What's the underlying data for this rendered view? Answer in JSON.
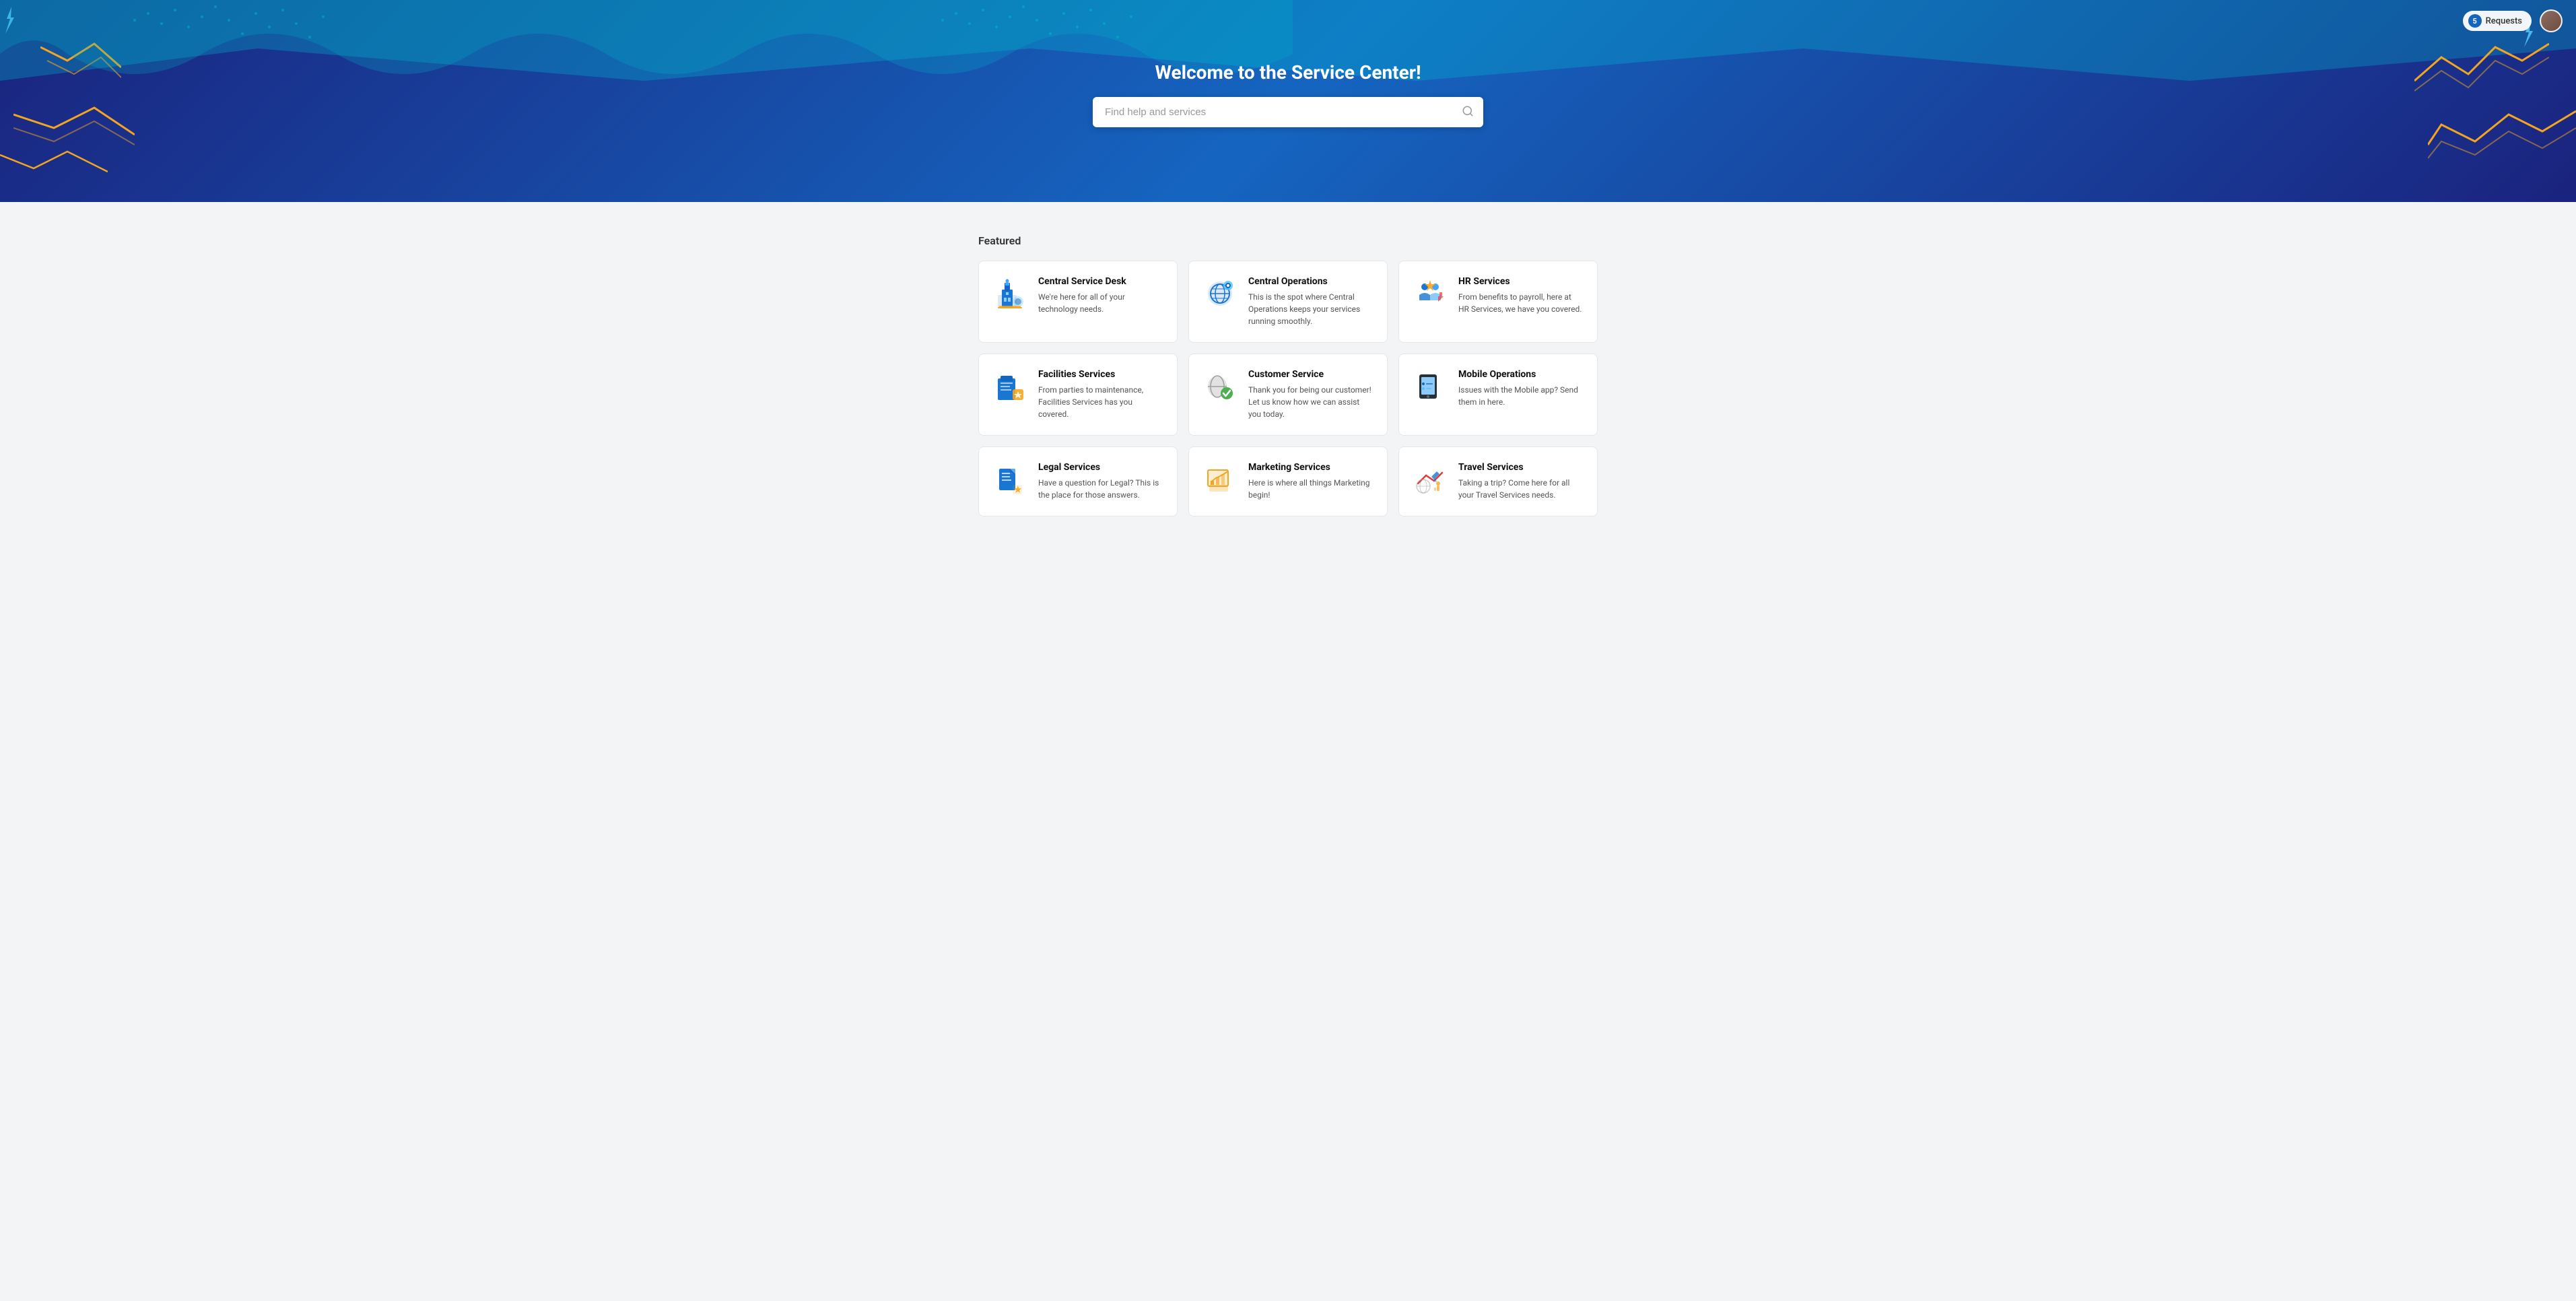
{
  "header": {
    "title": "Welcome to the Service Center!",
    "search_placeholder": "Find help and services",
    "top_nav": {
      "requests_label": "Requests",
      "requests_count": "5"
    }
  },
  "main": {
    "featured_label": "Featured",
    "cards": [
      {
        "id": "central-service-desk",
        "title": "Central Service Desk",
        "desc": "We're here for all of your technology needs.",
        "icon_color": "#1565c0",
        "icon_type": "building"
      },
      {
        "id": "central-operations",
        "title": "Central Operations",
        "desc": "This is the spot where Central Operations keeps your services running smoothly.",
        "icon_color": "#1565c0",
        "icon_type": "gear-globe"
      },
      {
        "id": "hr-services",
        "title": "HR Services",
        "desc": "From benefits to payroll, here at HR Services, we have you covered.",
        "icon_color": "#1565c0",
        "icon_type": "people-star"
      },
      {
        "id": "facilities-services",
        "title": "Facilities Services",
        "desc": "From parties to maintenance, Facilities Services has you covered.",
        "icon_color": "#f57c00",
        "icon_type": "facilities"
      },
      {
        "id": "customer-service",
        "title": "Customer Service",
        "desc": "Thank you for being our customer! Let us know how we can assist you today.",
        "icon_color": "#4caf50",
        "icon_type": "customer"
      },
      {
        "id": "mobile-operations",
        "title": "Mobile Operations",
        "desc": "Issues with the Mobile app? Send them in here.",
        "icon_color": "#1565c0",
        "icon_type": "mobile"
      },
      {
        "id": "legal-services",
        "title": "Legal Services",
        "desc": "Have a question for Legal? This is the place for those answers.",
        "icon_color": "#f57c00",
        "icon_type": "legal"
      },
      {
        "id": "marketing-services",
        "title": "Marketing Services",
        "desc": "Here is where all things Marketing begin!",
        "icon_color": "#f57c00",
        "icon_type": "marketing"
      },
      {
        "id": "travel-services",
        "title": "Travel Services",
        "desc": "Taking a trip? Come here for all your Travel Services needs.",
        "icon_color": "#e53935",
        "icon_type": "travel"
      }
    ]
  }
}
